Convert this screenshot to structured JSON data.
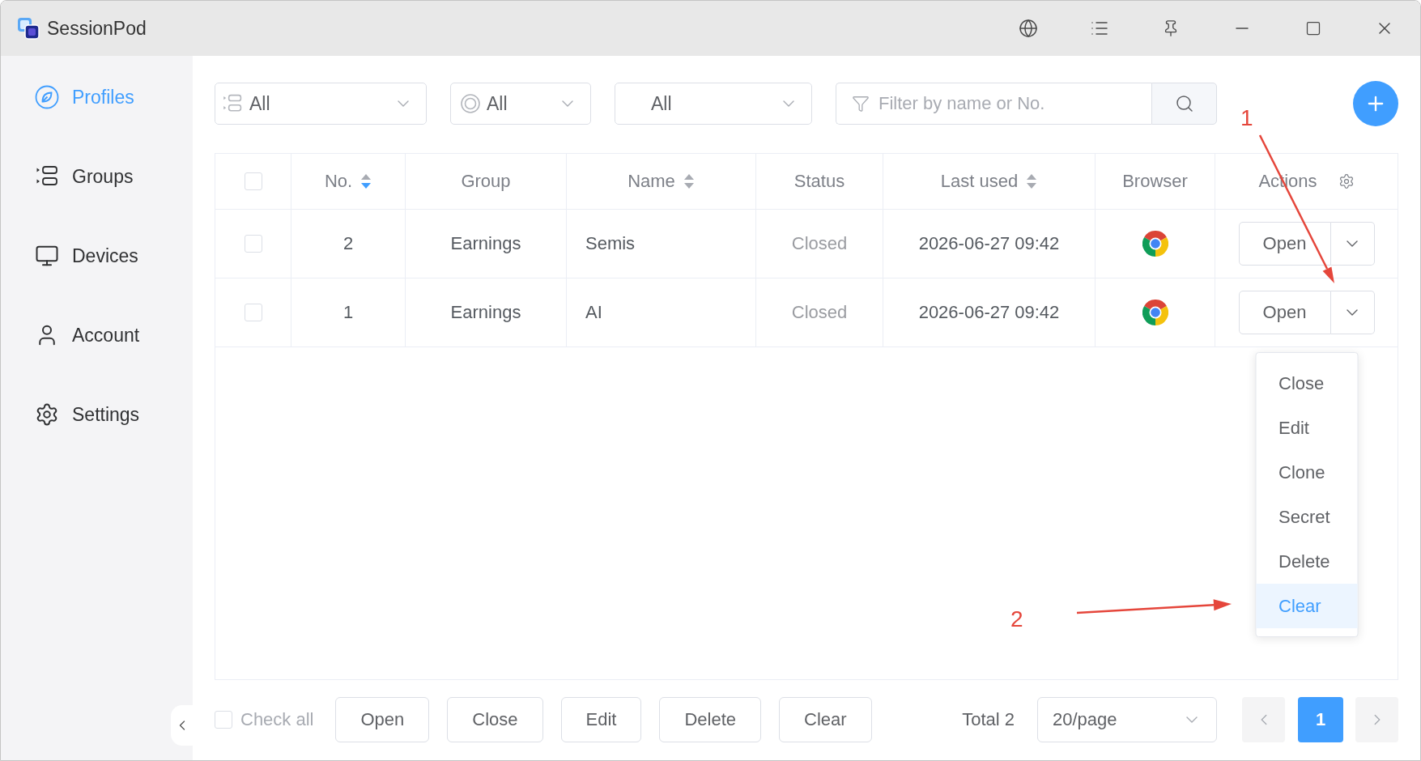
{
  "window": {
    "title": "SessionPod"
  },
  "sidebar": {
    "items": [
      {
        "label": "Profiles",
        "selected": true
      },
      {
        "label": "Groups",
        "selected": false
      },
      {
        "label": "Devices",
        "selected": false
      },
      {
        "label": "Account",
        "selected": false
      },
      {
        "label": "Settings",
        "selected": false
      }
    ]
  },
  "filters": [
    {
      "value": "All"
    },
    {
      "value": "All"
    },
    {
      "value": "All"
    }
  ],
  "search": {
    "placeholder": "Filter by name or No."
  },
  "table": {
    "columns": [
      {
        "kind": "select",
        "checked": false
      },
      {
        "kind": "sortable",
        "label": "No.",
        "sorted": true
      },
      {
        "kind": "text",
        "label": "Group"
      },
      {
        "kind": "sortable",
        "label": "Name",
        "sorted": false
      },
      {
        "kind": "text",
        "label": "Status"
      },
      {
        "kind": "sortable",
        "label": "Last used",
        "sorted": false
      },
      {
        "kind": "text",
        "label": "Browser"
      },
      {
        "kind": "actions",
        "label": "Actions"
      }
    ],
    "rows": [
      {
        "checked": false,
        "no": "2",
        "group": "Earnings",
        "name": "Semis",
        "status": "Closed",
        "last_used": "2026-06-27 09:42",
        "action": "Open"
      },
      {
        "checked": false,
        "no": "1",
        "group": "Earnings",
        "name": "AI",
        "status": "Closed",
        "last_used": "2026-06-27 09:42",
        "action": "Open",
        "menu": [
          {
            "label": "Close",
            "selected": false
          },
          {
            "label": "Edit",
            "selected": false
          },
          {
            "label": "Clone",
            "selected": false
          },
          {
            "label": "Secret",
            "selected": false
          },
          {
            "label": "Delete",
            "selected": false
          },
          {
            "label": "Clear",
            "selected": true
          }
        ]
      }
    ]
  },
  "footer": {
    "check_all": {
      "label": "Check all",
      "checked": false,
      "disabled": true
    },
    "buttons": [
      "Open",
      "Close",
      "Edit",
      "Delete",
      "Clear"
    ],
    "total": "Total 2",
    "page_size": "20/page",
    "pages": [
      {
        "label": "1",
        "selected": true
      }
    ]
  },
  "annotations": [
    {
      "label": "1"
    },
    {
      "label": "2"
    }
  ]
}
